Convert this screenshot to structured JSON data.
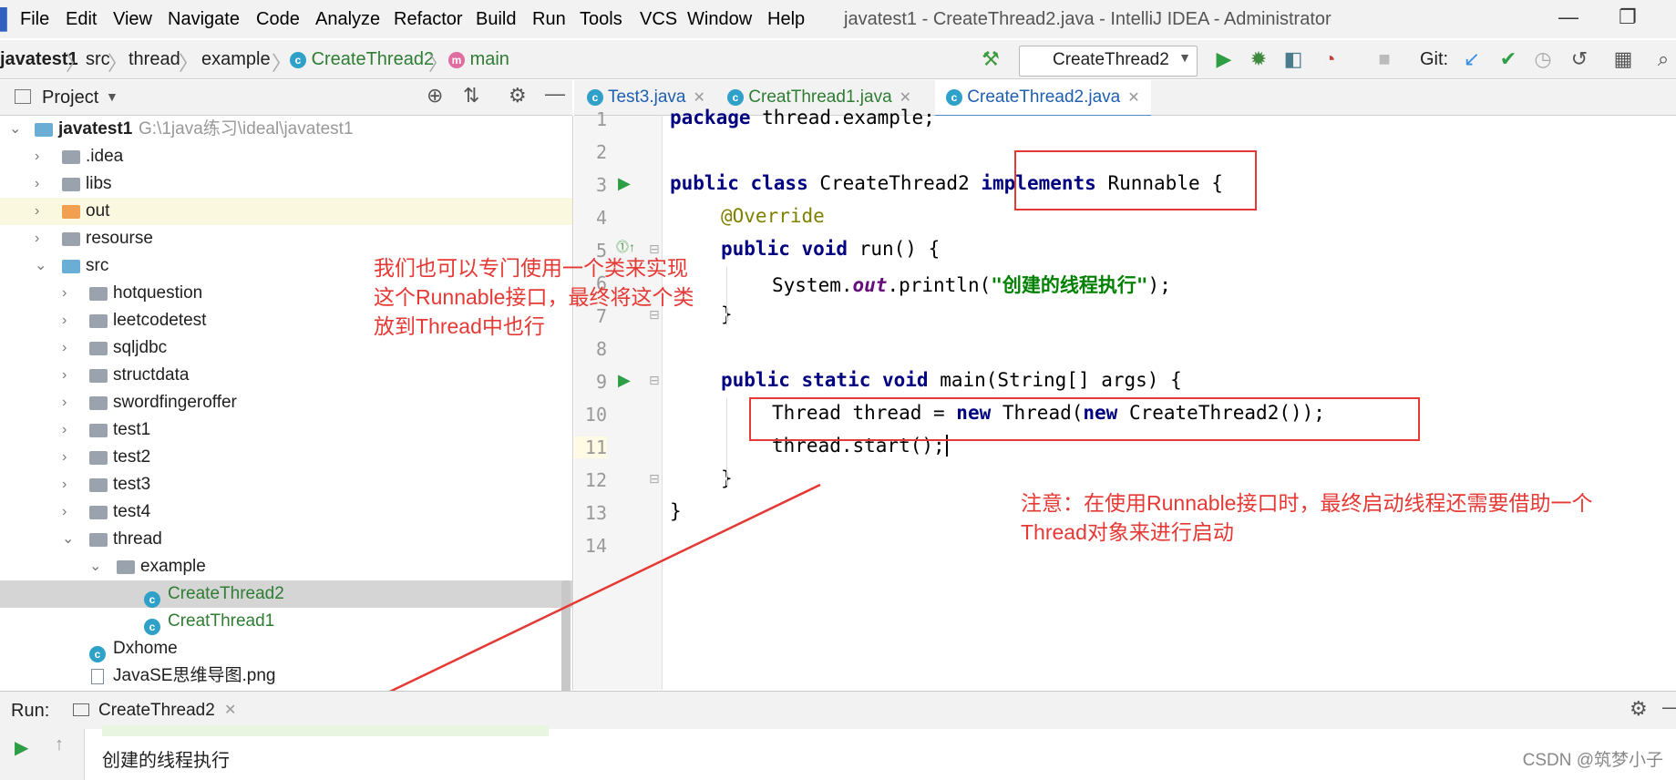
{
  "menubar": {
    "items": [
      "File",
      "Edit",
      "View",
      "Navigate",
      "Code",
      "Analyze",
      "Refactor",
      "Build",
      "Run",
      "Tools",
      "VCS",
      "Window",
      "Help"
    ],
    "window_title": "javatest1 - CreateThread2.java - IntelliJ IDEA - Administrator"
  },
  "breadcrumb": {
    "items": [
      "javatest1",
      "src",
      "thread",
      "example",
      "CreateThread2",
      "main"
    ]
  },
  "toolbar": {
    "run_config": "CreateThread2",
    "git_label": "Git:"
  },
  "project_panel": {
    "title": "Project",
    "tree": [
      {
        "label": "javatest1",
        "hint": "G:\\1java练习\\ideal\\javatest1"
      },
      {
        "label": ".idea"
      },
      {
        "label": "libs"
      },
      {
        "label": "out"
      },
      {
        "label": "resourse"
      },
      {
        "label": "src"
      },
      {
        "label": "hotquestion"
      },
      {
        "label": "leetcodetest"
      },
      {
        "label": "sqljdbc"
      },
      {
        "label": "structdata"
      },
      {
        "label": "swordfingeroffer"
      },
      {
        "label": "test1"
      },
      {
        "label": "test2"
      },
      {
        "label": "test3"
      },
      {
        "label": "test4"
      },
      {
        "label": "thread"
      },
      {
        "label": "example"
      },
      {
        "label": "CreateThread2"
      },
      {
        "label": "CreatThread1"
      },
      {
        "label": "Dxhome"
      },
      {
        "label": "JavaSE思维导图.png"
      }
    ]
  },
  "editor": {
    "tabs": [
      "Test3.java",
      "CreatThread1.java",
      "CreateThread2.java"
    ],
    "line_numbers": [
      "1",
      "2",
      "3",
      "4",
      "5",
      "6",
      "7",
      "8",
      "9",
      "10",
      "11",
      "12",
      "13",
      "14"
    ],
    "code": {
      "l1_kw": "package",
      "l1_rest": " thread.example;",
      "l3_a": "public class",
      "l3_b": " CreateThread2 ",
      "l3_c": "implements",
      "l3_d": " Runnable {",
      "l4": "@Override",
      "l5_a": "public void",
      "l5_b": " run() {",
      "l6_a": "System.",
      "l6_b": "out",
      "l6_c": ".println(",
      "l6_d": "\"创建的线程执行\"",
      "l6_e": ");",
      "l7": "}",
      "l9_a": "public static void",
      "l9_b": " main(String[] args) {",
      "l10_a": "Thread thread = ",
      "l10_b": "new",
      "l10_c": " Thread(",
      "l10_d": "new",
      "l10_e": " CreateThread2());",
      "l11": "thread.start();",
      "l12": "}",
      "l13": "}"
    }
  },
  "annotations": {
    "note1": [
      "我们也可以专门使用一个类来实现",
      "这个Runnable接口，最终将这个类",
      "放到Thread中也行"
    ],
    "note2": [
      "注意：在使用Runnable接口时，最终启动线程还需要借助一个",
      "Thread对象来进行启动"
    ],
    "color": "#e53935"
  },
  "run_panel": {
    "label": "Run:",
    "tab": "CreateThread2",
    "output": "创建的线程执行"
  },
  "watermark": "CSDN @筑梦小子"
}
